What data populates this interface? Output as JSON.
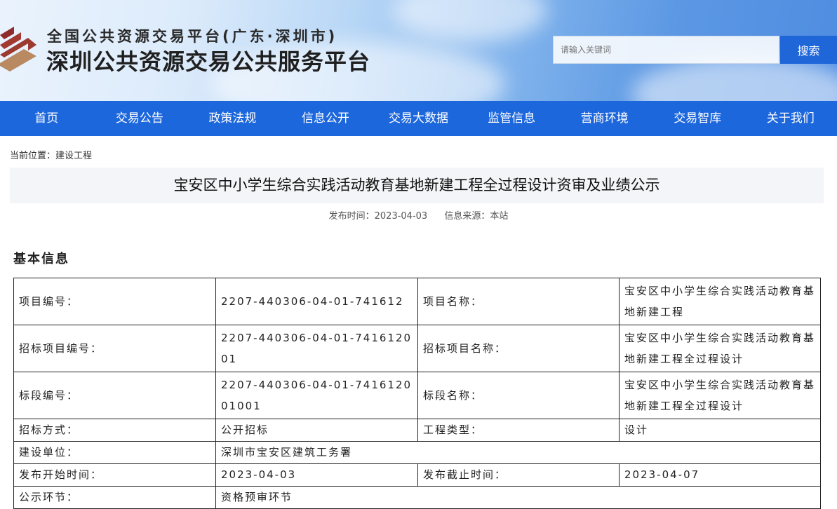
{
  "header": {
    "title_top": "全国公共资源交易平台(广东·深圳市)",
    "title_main": "深圳公共资源交易公共服务平台",
    "search_placeholder": "请输入关键词",
    "search_button": "搜索"
  },
  "nav": [
    {
      "label": "首页"
    },
    {
      "label": "交易公告"
    },
    {
      "label": "政策法规"
    },
    {
      "label": "信息公开"
    },
    {
      "label": "交易大数据"
    },
    {
      "label": "监管信息"
    },
    {
      "label": "营商环境"
    },
    {
      "label": "交易智库"
    },
    {
      "label": "关于我们"
    }
  ],
  "breadcrumb": "当前位置：建设工程",
  "article": {
    "title": "宝安区中小学生综合实践活动教育基地新建工程全过程设计资审及业绩公示",
    "publish_time": "发布时间：2023-04-03",
    "source": "信息来源：本站"
  },
  "section_title": "基本信息",
  "table": {
    "r1": {
      "l1": "项目编号：",
      "v1": "2207-440306-04-01-741612",
      "l2": "项目名称：",
      "v2": "宝安区中小学生综合实践活动教育基地新建工程"
    },
    "r2": {
      "l1": "招标项目编号：",
      "v1": "2207-440306-04-01-7416120 01",
      "l2": "招标项目名称：",
      "v2": "宝安区中小学生综合实践活动教育基地新建工程全过程设计"
    },
    "r3": {
      "l1": "标段编号：",
      "v1": "2207-440306-04-01-7416120 01001",
      "l2": "标段名称：",
      "v2": "宝安区中小学生综合实践活动教育基地新建工程全过程设计"
    },
    "r4": {
      "l1": "招标方式：",
      "v1": "公开招标",
      "l2": "工程类型：",
      "v2": "设计"
    },
    "r5": {
      "l1": "建设单位：",
      "v1": "深圳市宝安区建筑工务署"
    },
    "r6": {
      "l1": "发布开始时间：",
      "v1": "2023-04-03",
      "l2": "发布截止时间：",
      "v2": "2023-04-07"
    },
    "r7": {
      "l1": "公示环节：",
      "v1": "资格预审环节"
    }
  }
}
